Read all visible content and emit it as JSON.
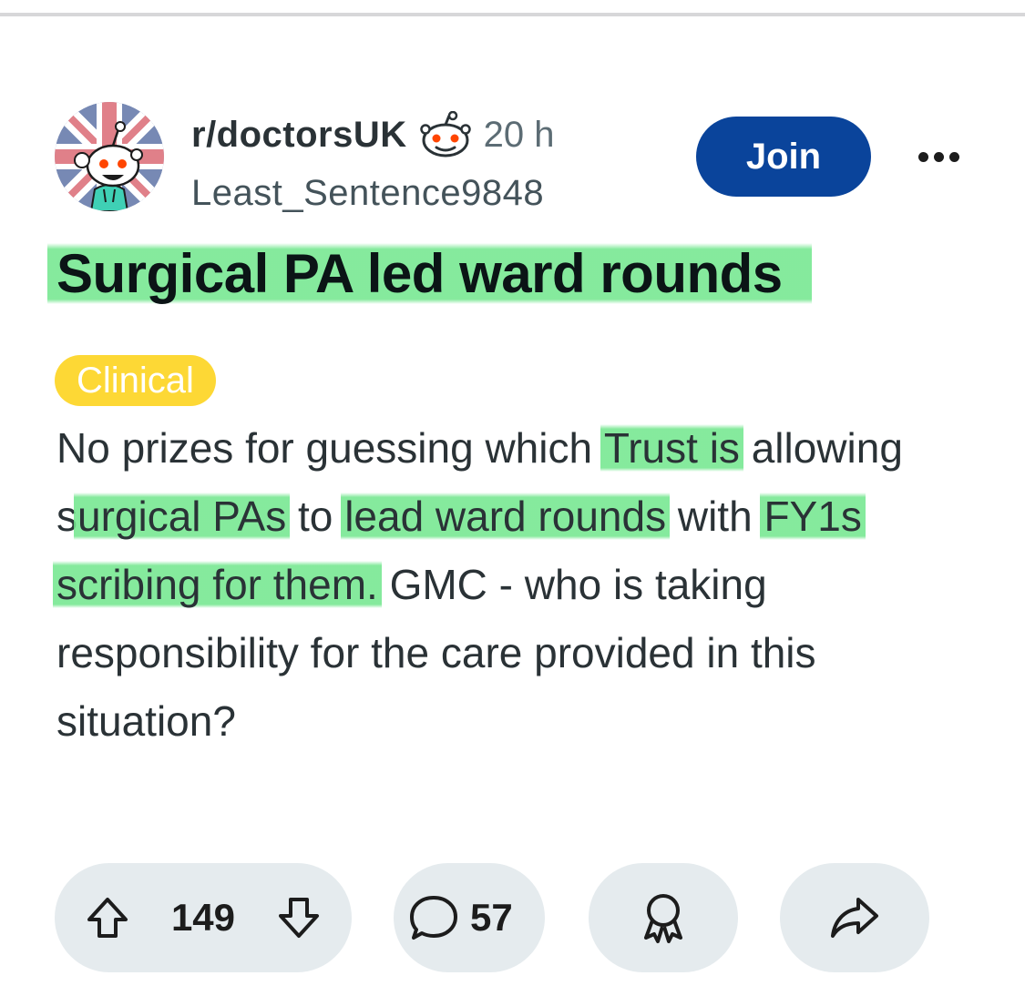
{
  "post": {
    "subreddit": "r/doctorsUK",
    "time": "20 h",
    "author": "Least_Sentence9848",
    "join_label": "Join",
    "title": "Surgical PA led ward rounds",
    "flair": "Clinical",
    "body": {
      "p1": "No prizes for guessing which ",
      "h1": "Trust is",
      "p2": " allowing s",
      "h2": "urgical PAs",
      "p3": " to ",
      "h3": "lead ward rounds",
      "p4": " with ",
      "h4": "FY1s scribing for them.",
      "p5": " GMC - who is taking responsibility for the care provided in this situation?"
    },
    "upvotes": "149",
    "comments": "57"
  },
  "colors": {
    "join_bg": "#0a449b",
    "flair_bg": "#fdd835",
    "highlight": "#70e68c",
    "action_pill_bg": "#e5ebee"
  },
  "icons": {
    "avatar": "snoo-doctor-union-jack-avatar",
    "op_badge": "snoo-head-icon",
    "more": "ellipsis-icon",
    "upvote": "upvote-arrow-icon",
    "downvote": "downvote-arrow-icon",
    "comments": "comment-bubble-icon",
    "award": "award-icon",
    "share": "share-arrow-icon"
  }
}
